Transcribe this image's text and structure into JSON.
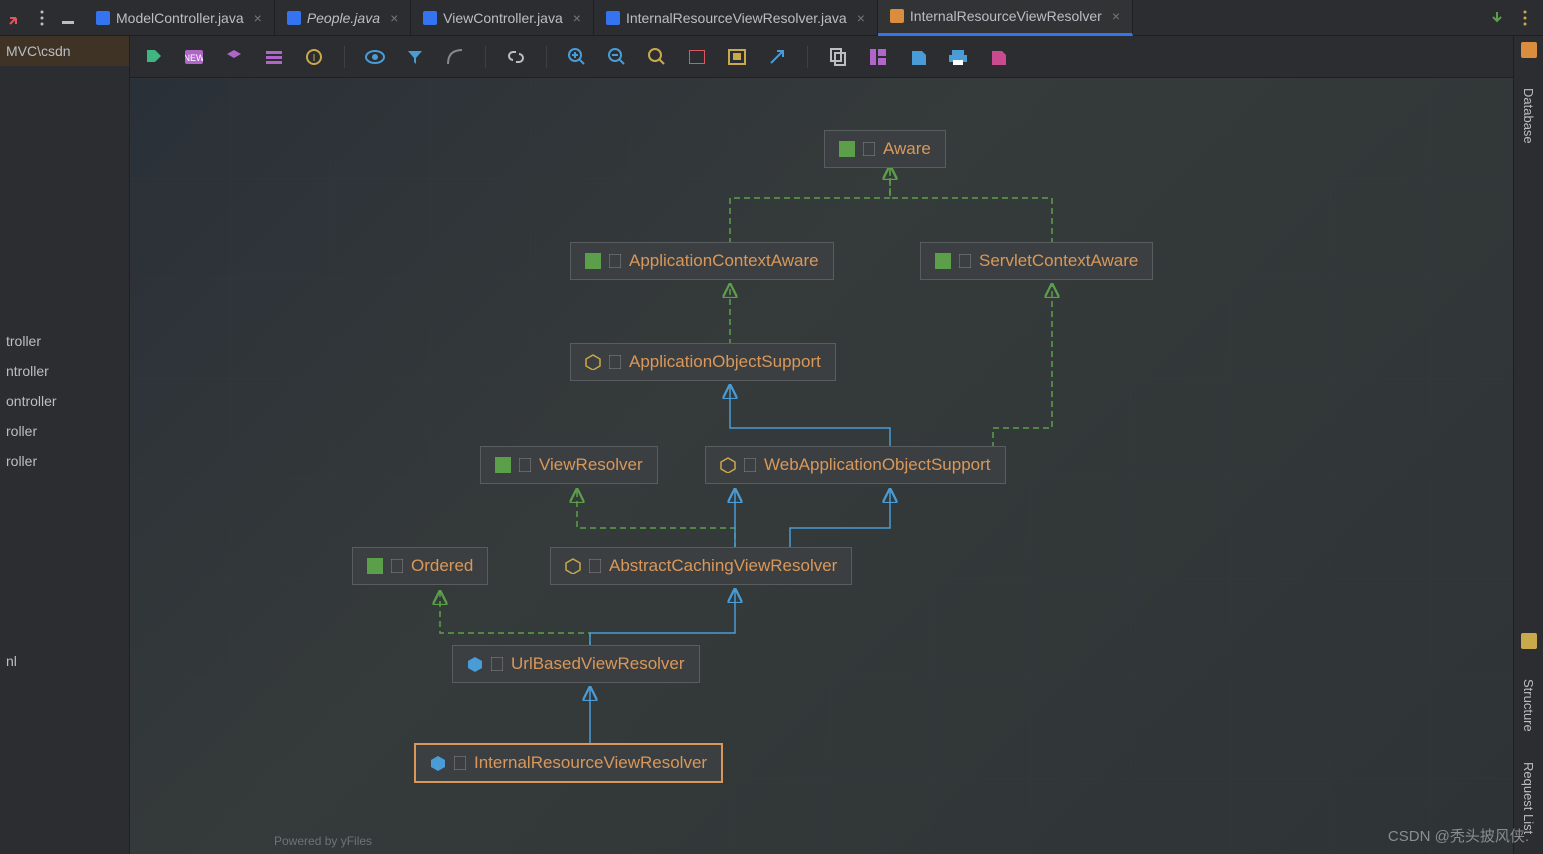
{
  "breadcrumb": "MVC\\csdn",
  "tabs": [
    {
      "label": "ModelController.java",
      "icon": "java",
      "italic": false,
      "active": false
    },
    {
      "label": "People.java",
      "icon": "java",
      "italic": true,
      "active": false
    },
    {
      "label": "ViewController.java",
      "icon": "java",
      "italic": false,
      "active": false
    },
    {
      "label": "InternalResourceViewResolver.java",
      "icon": "java",
      "italic": false,
      "active": false
    },
    {
      "label": "InternalResourceViewResolver",
      "icon": "diagram",
      "italic": false,
      "active": true
    }
  ],
  "tree": [
    "troller",
    "ntroller",
    "ontroller",
    "roller",
    "roller"
  ],
  "tree_last": "nl",
  "right": {
    "database": "Database",
    "structure": "Structure",
    "request": "Request List"
  },
  "nodes": {
    "aware": "Aware",
    "aca": "ApplicationContextAware",
    "sca": "ServletContextAware",
    "aos": "ApplicationObjectSupport",
    "vr": "ViewResolver",
    "waos": "WebApplicationObjectSupport",
    "ordered": "Ordered",
    "acvr": "AbstractCachingViewResolver",
    "ubvr": "UrlBasedViewResolver",
    "irvr": "InternalResourceViewResolver"
  },
  "footer": "Powered by yFiles",
  "watermark": "CSDN @秃头披风侠."
}
